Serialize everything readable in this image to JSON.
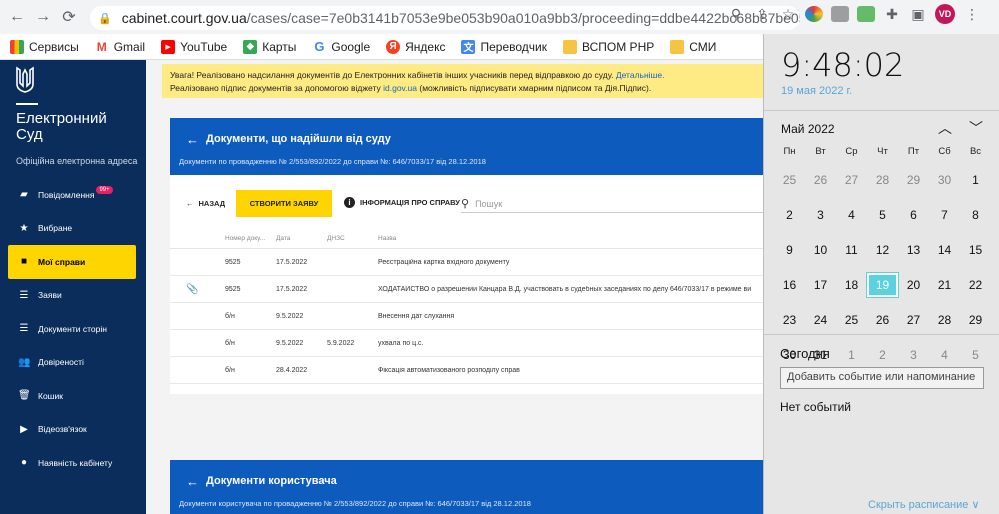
{
  "browser": {
    "url_host": "cabinet.court.gov.ua",
    "url_path": "/cases/case=7e0b3141b7053e9be053b90a010a9bb3/proceeding=ddbe4422bc68b87be0531...",
    "profile_initials": "VD"
  },
  "bookmarks": [
    {
      "label": "Сервисы",
      "icon": "apps-icon"
    },
    {
      "label": "Gmail",
      "icon": "gmail-icon"
    },
    {
      "label": "YouTube",
      "icon": "youtube-icon"
    },
    {
      "label": "Карты",
      "icon": "maps-icon"
    },
    {
      "label": "Google",
      "icon": "google-icon"
    },
    {
      "label": "Яндекс",
      "icon": "yandex-icon"
    },
    {
      "label": "Переводчик",
      "icon": "translate-icon"
    },
    {
      "label": "ВСПОМ РНР",
      "icon": "folder-icon"
    },
    {
      "label": "СМИ",
      "icon": "folder-icon"
    }
  ],
  "sidebar": {
    "title": "Електронний Суд",
    "subtitle": "Офіційна електронна адреса",
    "items": [
      {
        "label": "Повідомлення",
        "badge": "99+"
      },
      {
        "label": "Вибране"
      },
      {
        "label": "Мої справи"
      },
      {
        "label": "Заяви"
      },
      {
        "label": "Документи сторін"
      },
      {
        "label": "Довіреності"
      },
      {
        "label": "Кошик"
      },
      {
        "label": "Відеозв'язок"
      },
      {
        "label": "Наявність кабінету"
      }
    ]
  },
  "banner": {
    "line1": "Увага! Реалізовано надсилання документів до Електронних кабінетів інших учасників перед відправкою до суду.",
    "line1_link": "Детальніше.",
    "line2_pre": "Реалізовано підпис документів за допомогою віджету",
    "line2_link": "id.gov.ua",
    "line2_post": "(можливість підписувати хмарним підписом та Дія.Підпис)."
  },
  "court_docs": {
    "title": "Документи, що надійшли від суду",
    "subtitle": "Документи по провадженню № 2/553/892/2022 до справи №: 646/7033/17 від 28.12.2018",
    "back_label": "НАЗАД",
    "create_label": "СТВОРИТИ ЗАЯВУ",
    "info_label": "ІНФОРМАЦІЯ ПРО СПРАВУ",
    "search_placeholder": "Пошук",
    "columns": [
      "Номер доку...",
      "Дата",
      "ДНЗС",
      "Назва"
    ],
    "rows": [
      {
        "num": "9525",
        "date": "17.5.2022",
        "dnzs": "",
        "name": "Реєстраційна картка вхідного документу",
        "clip": ""
      },
      {
        "num": "9525",
        "date": "17.5.2022",
        "dnzs": "",
        "name": "ХОДАТАЙСТВО о разрешении Канцара В.Д. участвовать в судебных заседаниях по делу 646/7033/17 в режиме ви",
        "clip": "📎"
      },
      {
        "num": "б/н",
        "date": "9.5.2022",
        "dnzs": "",
        "name": "Внесення дат слухання",
        "clip": ""
      },
      {
        "num": "б/н",
        "date": "9.5.2022",
        "dnzs": "5.9.2022",
        "name": "ухвала по ц.с.",
        "clip": ""
      },
      {
        "num": "б/н",
        "date": "28.4.2022",
        "dnzs": "",
        "name": "Фіксація автоматизованого розподілу справ",
        "clip": ""
      }
    ]
  },
  "user_docs": {
    "title": "Документи користувача",
    "subtitle": "Документи користувача по провадженню № 2/553/892/2022 до справи №: 646/7033/17 від 28.12.2018"
  },
  "calendar": {
    "time": "9:48:02",
    "date": "19 мая 2022 г.",
    "month": "Май 2022",
    "weekdays": [
      "Пн",
      "Вт",
      "Ср",
      "Чт",
      "Пт",
      "Сб",
      "Вс"
    ],
    "weeks": [
      [
        "25",
        "26",
        "27",
        "28",
        "29",
        "30",
        "1"
      ],
      [
        "2",
        "3",
        "4",
        "5",
        "6",
        "7",
        "8"
      ],
      [
        "9",
        "10",
        "11",
        "12",
        "13",
        "14",
        "15"
      ],
      [
        "16",
        "17",
        "18",
        "19",
        "20",
        "21",
        "22"
      ],
      [
        "23",
        "24",
        "25",
        "26",
        "27",
        "28",
        "29"
      ],
      [
        "30",
        "31",
        "1",
        "2",
        "3",
        "4",
        "5"
      ]
    ],
    "today": "19",
    "today_label": "Сегодня",
    "add_event": "Добавить событие или напоминание",
    "no_events": "Нет событий",
    "hide_schedule": "Скрыть расписание ∨"
  }
}
